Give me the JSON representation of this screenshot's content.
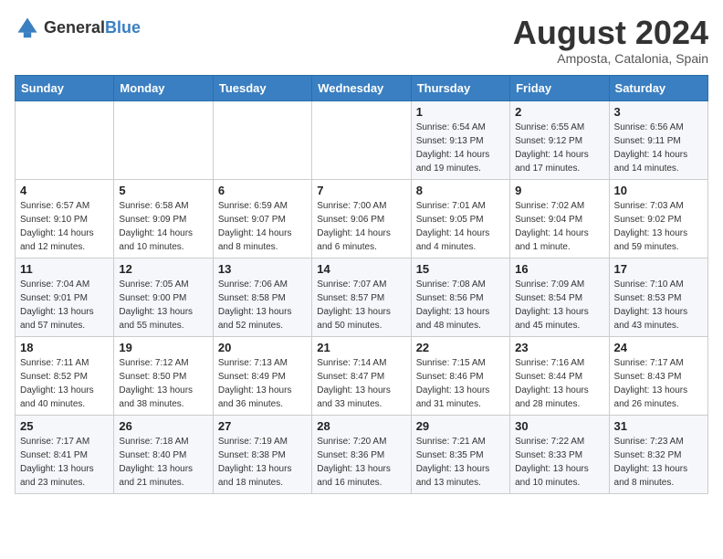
{
  "logo": {
    "general": "General",
    "blue": "Blue"
  },
  "title": {
    "month_year": "August 2024",
    "location": "Amposta, Catalonia, Spain"
  },
  "days_of_week": [
    "Sunday",
    "Monday",
    "Tuesday",
    "Wednesday",
    "Thursday",
    "Friday",
    "Saturday"
  ],
  "weeks": [
    [
      {
        "day": "",
        "info": ""
      },
      {
        "day": "",
        "info": ""
      },
      {
        "day": "",
        "info": ""
      },
      {
        "day": "",
        "info": ""
      },
      {
        "day": "1",
        "info": "Sunrise: 6:54 AM\nSunset: 9:13 PM\nDaylight: 14 hours\nand 19 minutes."
      },
      {
        "day": "2",
        "info": "Sunrise: 6:55 AM\nSunset: 9:12 PM\nDaylight: 14 hours\nand 17 minutes."
      },
      {
        "day": "3",
        "info": "Sunrise: 6:56 AM\nSunset: 9:11 PM\nDaylight: 14 hours\nand 14 minutes."
      }
    ],
    [
      {
        "day": "4",
        "info": "Sunrise: 6:57 AM\nSunset: 9:10 PM\nDaylight: 14 hours\nand 12 minutes."
      },
      {
        "day": "5",
        "info": "Sunrise: 6:58 AM\nSunset: 9:09 PM\nDaylight: 14 hours\nand 10 minutes."
      },
      {
        "day": "6",
        "info": "Sunrise: 6:59 AM\nSunset: 9:07 PM\nDaylight: 14 hours\nand 8 minutes."
      },
      {
        "day": "7",
        "info": "Sunrise: 7:00 AM\nSunset: 9:06 PM\nDaylight: 14 hours\nand 6 minutes."
      },
      {
        "day": "8",
        "info": "Sunrise: 7:01 AM\nSunset: 9:05 PM\nDaylight: 14 hours\nand 4 minutes."
      },
      {
        "day": "9",
        "info": "Sunrise: 7:02 AM\nSunset: 9:04 PM\nDaylight: 14 hours\nand 1 minute."
      },
      {
        "day": "10",
        "info": "Sunrise: 7:03 AM\nSunset: 9:02 PM\nDaylight: 13 hours\nand 59 minutes."
      }
    ],
    [
      {
        "day": "11",
        "info": "Sunrise: 7:04 AM\nSunset: 9:01 PM\nDaylight: 13 hours\nand 57 minutes."
      },
      {
        "day": "12",
        "info": "Sunrise: 7:05 AM\nSunset: 9:00 PM\nDaylight: 13 hours\nand 55 minutes."
      },
      {
        "day": "13",
        "info": "Sunrise: 7:06 AM\nSunset: 8:58 PM\nDaylight: 13 hours\nand 52 minutes."
      },
      {
        "day": "14",
        "info": "Sunrise: 7:07 AM\nSunset: 8:57 PM\nDaylight: 13 hours\nand 50 minutes."
      },
      {
        "day": "15",
        "info": "Sunrise: 7:08 AM\nSunset: 8:56 PM\nDaylight: 13 hours\nand 48 minutes."
      },
      {
        "day": "16",
        "info": "Sunrise: 7:09 AM\nSunset: 8:54 PM\nDaylight: 13 hours\nand 45 minutes."
      },
      {
        "day": "17",
        "info": "Sunrise: 7:10 AM\nSunset: 8:53 PM\nDaylight: 13 hours\nand 43 minutes."
      }
    ],
    [
      {
        "day": "18",
        "info": "Sunrise: 7:11 AM\nSunset: 8:52 PM\nDaylight: 13 hours\nand 40 minutes."
      },
      {
        "day": "19",
        "info": "Sunrise: 7:12 AM\nSunset: 8:50 PM\nDaylight: 13 hours\nand 38 minutes."
      },
      {
        "day": "20",
        "info": "Sunrise: 7:13 AM\nSunset: 8:49 PM\nDaylight: 13 hours\nand 36 minutes."
      },
      {
        "day": "21",
        "info": "Sunrise: 7:14 AM\nSunset: 8:47 PM\nDaylight: 13 hours\nand 33 minutes."
      },
      {
        "day": "22",
        "info": "Sunrise: 7:15 AM\nSunset: 8:46 PM\nDaylight: 13 hours\nand 31 minutes."
      },
      {
        "day": "23",
        "info": "Sunrise: 7:16 AM\nSunset: 8:44 PM\nDaylight: 13 hours\nand 28 minutes."
      },
      {
        "day": "24",
        "info": "Sunrise: 7:17 AM\nSunset: 8:43 PM\nDaylight: 13 hours\nand 26 minutes."
      }
    ],
    [
      {
        "day": "25",
        "info": "Sunrise: 7:17 AM\nSunset: 8:41 PM\nDaylight: 13 hours\nand 23 minutes."
      },
      {
        "day": "26",
        "info": "Sunrise: 7:18 AM\nSunset: 8:40 PM\nDaylight: 13 hours\nand 21 minutes."
      },
      {
        "day": "27",
        "info": "Sunrise: 7:19 AM\nSunset: 8:38 PM\nDaylight: 13 hours\nand 18 minutes."
      },
      {
        "day": "28",
        "info": "Sunrise: 7:20 AM\nSunset: 8:36 PM\nDaylight: 13 hours\nand 16 minutes."
      },
      {
        "day": "29",
        "info": "Sunrise: 7:21 AM\nSunset: 8:35 PM\nDaylight: 13 hours\nand 13 minutes."
      },
      {
        "day": "30",
        "info": "Sunrise: 7:22 AM\nSunset: 8:33 PM\nDaylight: 13 hours\nand 10 minutes."
      },
      {
        "day": "31",
        "info": "Sunrise: 7:23 AM\nSunset: 8:32 PM\nDaylight: 13 hours\nand 8 minutes."
      }
    ]
  ]
}
